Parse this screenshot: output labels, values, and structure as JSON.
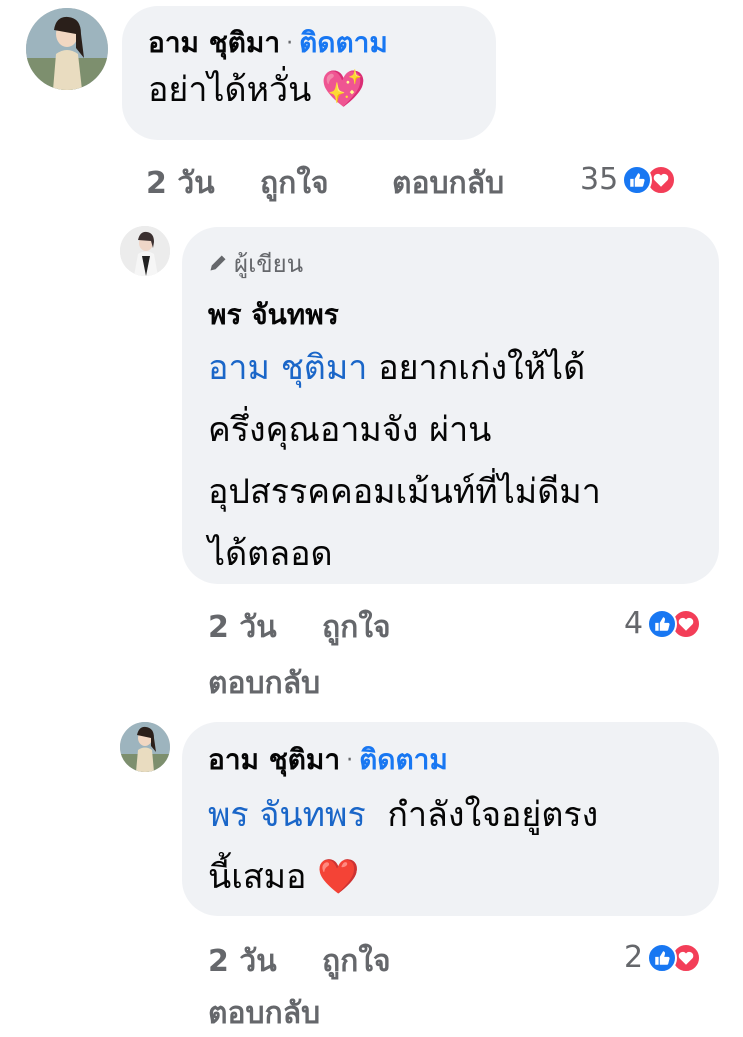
{
  "comment1": {
    "name": "อาม ชุติมา",
    "dot": "·",
    "follow": "ติดตาม",
    "text": "อย่าได้หวั่น",
    "emoji": "💖",
    "time": "2 วัน",
    "like": "ถูกใจ",
    "reply": "ตอบกลับ",
    "reaction_count": "35"
  },
  "reply1": {
    "badge": "ผู้เขียน",
    "name": "พร จันทพร",
    "mention": "อาม ชุติมา",
    "text_line1": "อยากเก่งให้ได้",
    "text_line2": "ครึ่งคุณอามจัง ผ่าน",
    "text_line3": "อุปสรรคคอมเม้นท์ที่ไม่ดีมา",
    "text_line4": "ได้ตลอด",
    "time": "2 วัน",
    "like": "ถูกใจ",
    "reply": "ตอบกลับ",
    "reaction_count": "4"
  },
  "reply2": {
    "name": "อาม ชุติมา",
    "dot": "·",
    "follow": "ติดตาม",
    "mention": "พร จันทพร",
    "text_line1": "กำลังใจอยู่ตรง",
    "text_line2": "นี้เสมอ",
    "emoji": "❤️",
    "time": "2 วัน",
    "like": "ถูกใจ",
    "reply": "ตอบกลับ",
    "reaction_count": "2"
  },
  "colors": {
    "bubble": "#f0f2f5",
    "link": "#1877f2",
    "meta": "#65676b",
    "like": "#1877f2",
    "love": "#f33e58"
  },
  "icons": [
    "like-reaction-icon",
    "love-reaction-icon",
    "pencil-icon"
  ]
}
